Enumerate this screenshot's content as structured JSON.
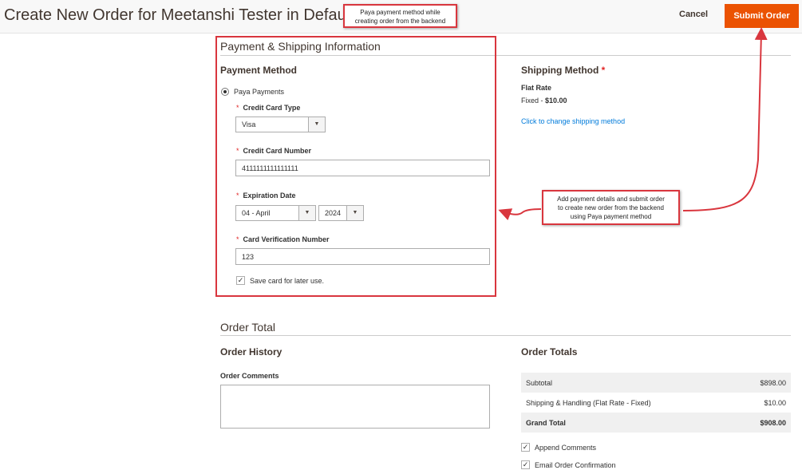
{
  "header": {
    "title": "Create New Order for Meetanshi Tester in Default Store View",
    "cancel_label": "Cancel",
    "submit_label": "Submit Order"
  },
  "callouts": {
    "top": [
      "Paya payment method while",
      "creating order from the backend"
    ],
    "middle": [
      "Add payment details and submit order",
      "to create new order from the backend",
      "using Paya payment method"
    ]
  },
  "payment_shipping": {
    "section_title": "Payment & Shipping Information",
    "payment": {
      "title": "Payment Method",
      "method_label": "Paya Payments",
      "cc_type_label": "Credit Card Type",
      "cc_type_value": "Visa",
      "cc_number_label": "Credit Card Number",
      "cc_number_value": "4111111111111111",
      "expiration_label": "Expiration Date",
      "exp_month": "04 - April",
      "exp_year": "2024",
      "cvv_label": "Card Verification Number",
      "cvv_value": "123",
      "save_card_label": "Save card for later use."
    },
    "shipping": {
      "title": "Shipping Method",
      "required_mark": "*",
      "method_name": "Flat Rate",
      "method_prefix": "Fixed - ",
      "method_price": "$10.00",
      "change_link": "Click to change shipping method"
    }
  },
  "order_total": {
    "section_title": "Order Total",
    "history_title": "Order History",
    "comments_label": "Order Comments",
    "totals_title": "Order Totals",
    "rows": [
      {
        "name": "Subtotal",
        "value": "$898.00"
      },
      {
        "name": "Shipping & Handling (Flat Rate - Fixed)",
        "value": "$10.00"
      },
      {
        "name": "Grand Total",
        "value": "$908.00"
      }
    ],
    "append_comments_label": "Append Comments",
    "email_confirmation_label": "Email Order Confirmation"
  },
  "icons": {
    "arrow_down": "▼",
    "check": "✓"
  },
  "colors": {
    "accent": "#eb5202",
    "annotation": "#d9363e",
    "link": "#007bdb",
    "required": "#e22626"
  }
}
